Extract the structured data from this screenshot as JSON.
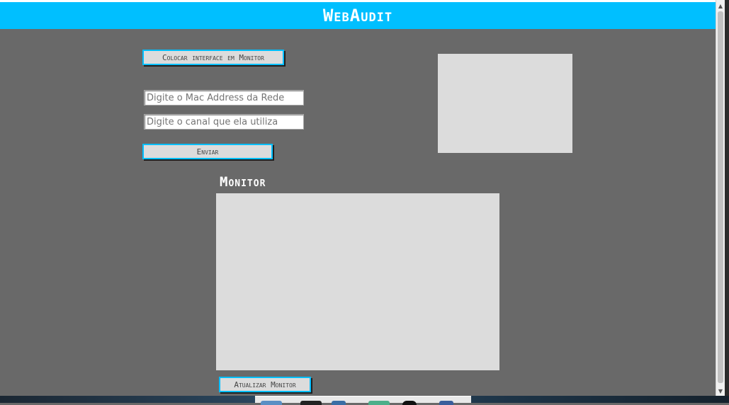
{
  "header": {
    "title": "WebAudit"
  },
  "controls": {
    "monitor_mode_button": "Colocar interface em Monitor",
    "mac_input_placeholder": "Digite o Mac Address da Rede",
    "mac_input_value": "",
    "channel_input_placeholder": "Digite o canal que ela utiliza",
    "channel_input_value": "",
    "send_button": "Enviar"
  },
  "monitor": {
    "title": "Monitor",
    "refresh_button": "Atualizar Monitor"
  },
  "colors": {
    "accent": "#00bfff",
    "background": "#696969",
    "panel": "#dcdcdc"
  }
}
